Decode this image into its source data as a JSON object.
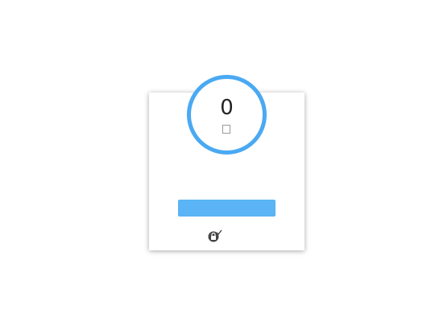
{
  "dialog": {
    "countdown": "0",
    "unit_glyph": "",
    "title": "",
    "subtitle": "",
    "button_label": "",
    "security_text": ""
  },
  "colors": {
    "accent": "#4aa9f2",
    "button": "#5ab4f5",
    "icon": "#444444"
  },
  "icons": [
    "lock-check-icon"
  ]
}
